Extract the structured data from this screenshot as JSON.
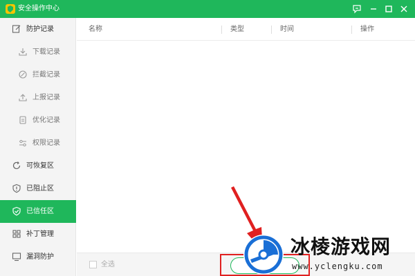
{
  "window": {
    "title": "安全操作中心",
    "controls": [
      "feedback-icon",
      "minimize-icon",
      "maximize-icon",
      "close-icon"
    ]
  },
  "sidebar": {
    "items": [
      {
        "label": "防护记录",
        "icon": "edit-icon",
        "level": 0,
        "active": false
      },
      {
        "label": "下载记录",
        "icon": "download-icon",
        "level": 1,
        "active": false
      },
      {
        "label": "拦截记录",
        "icon": "block-icon",
        "level": 1,
        "active": false
      },
      {
        "label": "上报记录",
        "icon": "upload-icon",
        "level": 1,
        "active": false
      },
      {
        "label": "优化记录",
        "icon": "document-icon",
        "level": 1,
        "active": false
      },
      {
        "label": "权限记录",
        "icon": "sliders-icon",
        "level": 1,
        "active": false
      },
      {
        "label": "可恢复区",
        "icon": "refresh-icon",
        "level": 0,
        "active": false
      },
      {
        "label": "已阻止区",
        "icon": "shield-alert-icon",
        "level": 0,
        "active": false
      },
      {
        "label": "已信任区",
        "icon": "shield-check-icon",
        "level": 0,
        "active": true
      },
      {
        "label": "补丁管理",
        "icon": "grid-icon",
        "level": 0,
        "active": false
      },
      {
        "label": "漏洞防护",
        "icon": "monitor-icon",
        "level": 0,
        "active": false
      }
    ]
  },
  "table": {
    "columns": [
      "名称",
      "类型",
      "时间",
      "操作"
    ],
    "rows": []
  },
  "footer": {
    "select_all_label": "全选"
  },
  "watermark": {
    "title": "冰棱游戏网",
    "url": "www.yclengku.com"
  },
  "colors": {
    "brand_green": "#1fb75b",
    "annotation_red": "#e02020"
  }
}
